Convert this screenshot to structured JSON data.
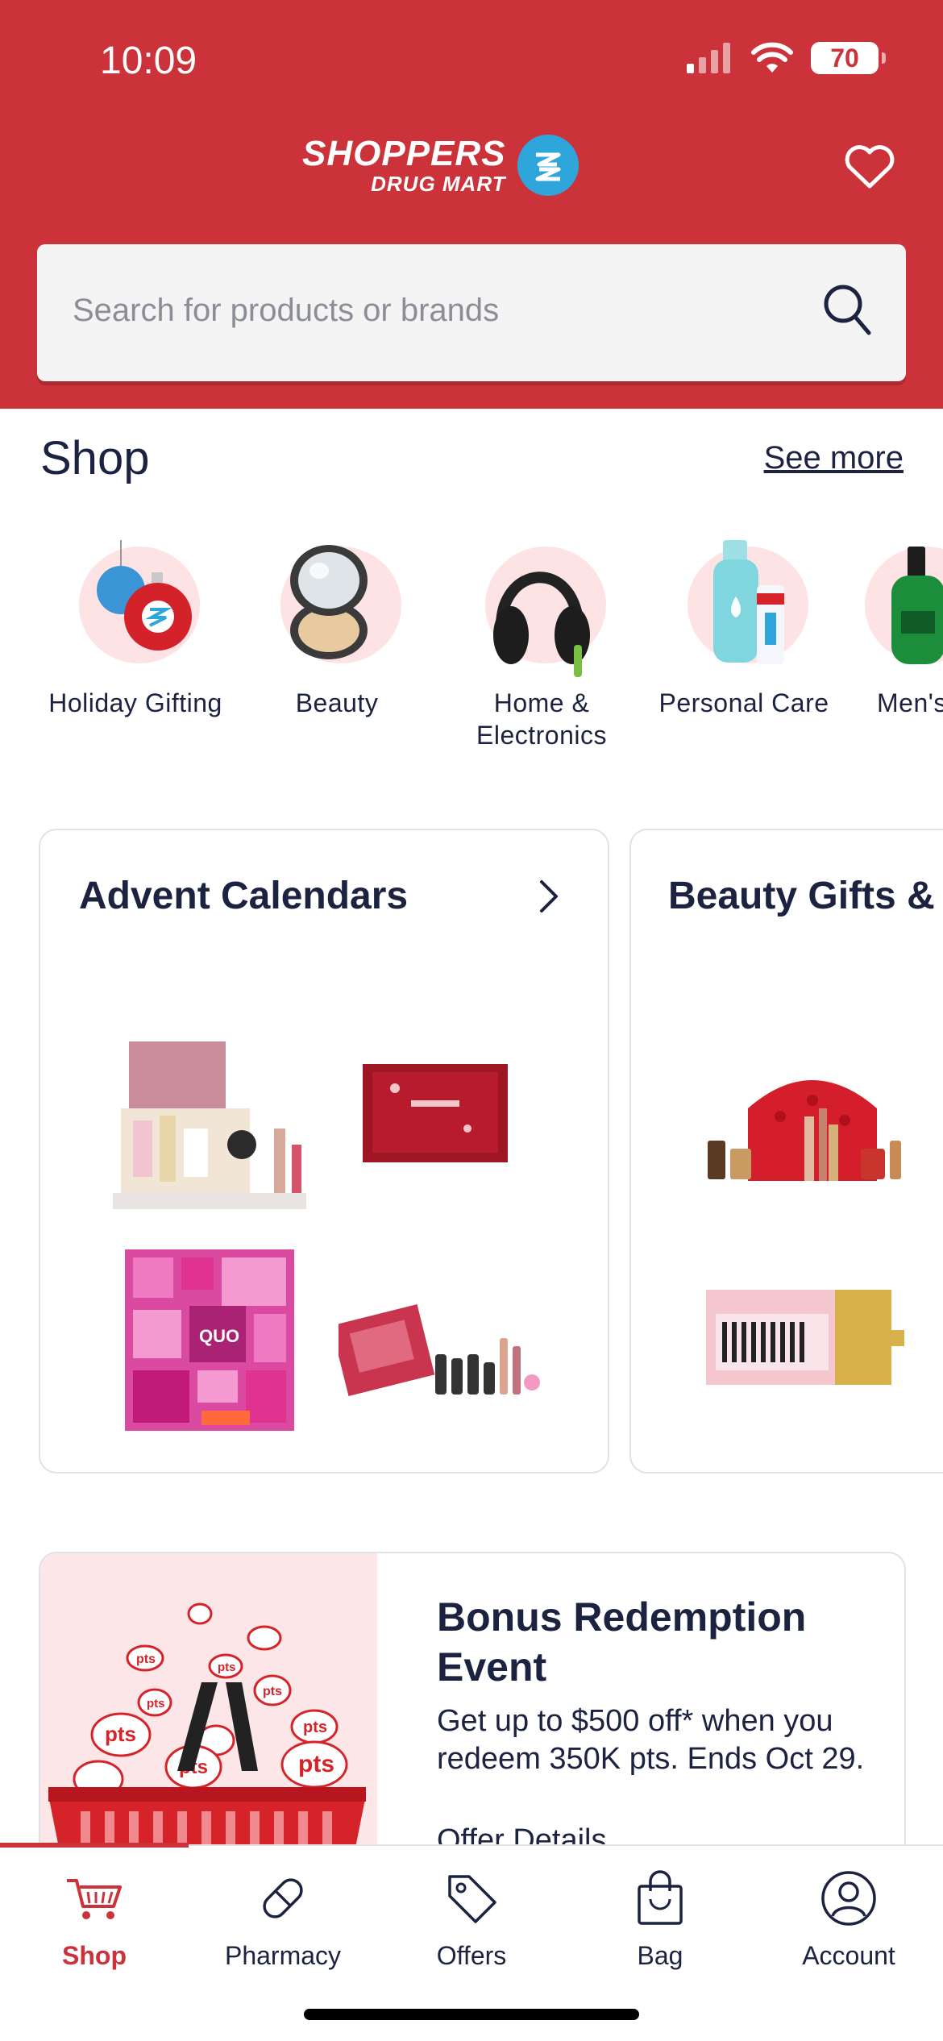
{
  "status_bar": {
    "time": "10:09",
    "battery": "70",
    "icons": [
      "signal-icon",
      "wifi-icon",
      "battery-icon"
    ]
  },
  "header": {
    "brand_main": "SHOPPERS",
    "brand_sub": "DRUG MART",
    "favorites_icon": "heart-icon",
    "brand_color": "#cc3239"
  },
  "search": {
    "placeholder": "Search for products or brands",
    "icon": "search-icon"
  },
  "shop": {
    "title": "Shop",
    "see_more": "See more",
    "categories": [
      {
        "label": "Holiday Gifting",
        "icon": "ornament-icon"
      },
      {
        "label": "Beauty",
        "icon": "compact-mirror-icon"
      },
      {
        "label": "Home & Electronics",
        "icon": "headphones-icon"
      },
      {
        "label": "Personal Care",
        "icon": "toiletries-icon"
      },
      {
        "label": "Men's",
        "icon": "cologne-icon"
      }
    ]
  },
  "cards": [
    {
      "title": "Advent Calendars"
    },
    {
      "title": "Beauty Gifts & Sets"
    }
  ],
  "promo": {
    "title": "Bonus Redemption Event",
    "body": "Get up to $500 off* when you redeem 350K pts. Ends Oct 29.",
    "link": "Offer Details",
    "badge_text": "pts"
  },
  "tabs": [
    {
      "label": "Shop",
      "icon": "cart-icon",
      "active": true
    },
    {
      "label": "Pharmacy",
      "icon": "pill-icon",
      "active": false
    },
    {
      "label": "Offers",
      "icon": "tag-icon",
      "active": false
    },
    {
      "label": "Bag",
      "icon": "bag-icon",
      "active": false
    },
    {
      "label": "Account",
      "icon": "account-icon",
      "active": false
    }
  ]
}
